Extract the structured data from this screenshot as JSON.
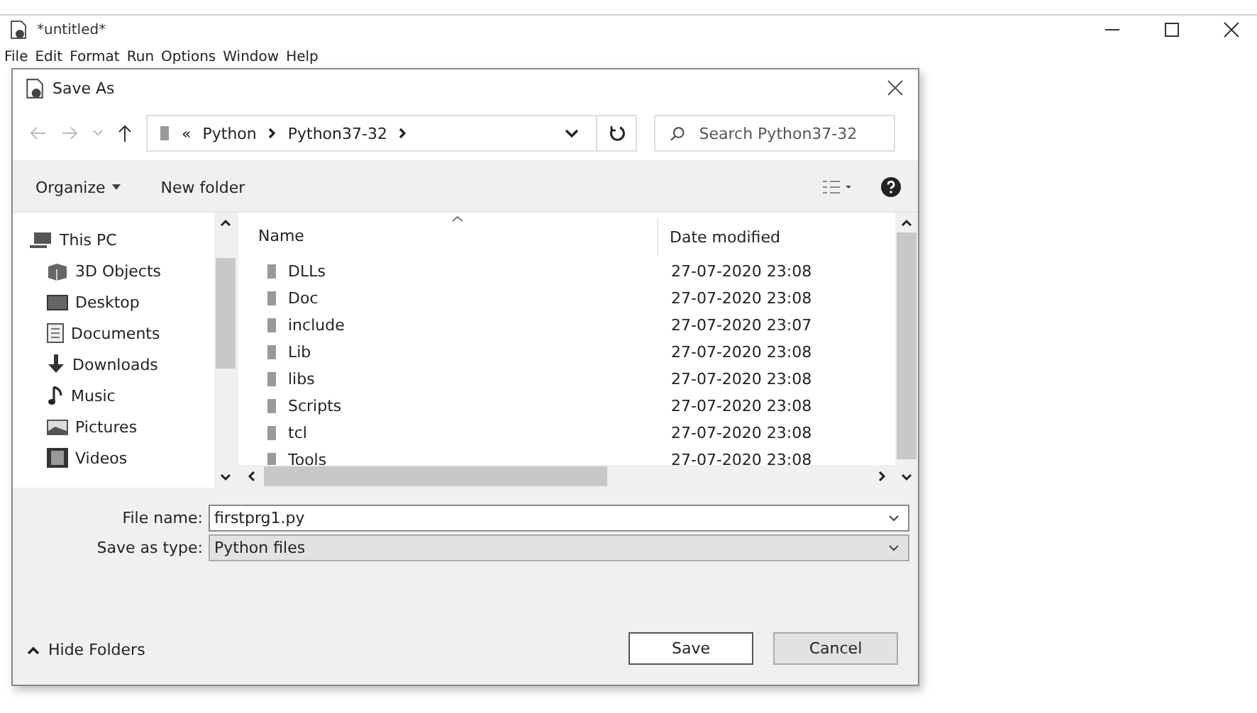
{
  "window": {
    "title": "*untitled*",
    "menu": [
      "File",
      "Edit",
      "Format",
      "Run",
      "Options",
      "Window",
      "Help"
    ]
  },
  "dialog": {
    "title": "Save As",
    "address": {
      "overflow_mark": "«",
      "path": [
        "Python",
        "Python37-32"
      ]
    },
    "search": {
      "placeholder": "Search Python37-32"
    },
    "toolbar": {
      "organize": "Organize",
      "new_folder": "New folder"
    },
    "sidebar": {
      "items": [
        {
          "label": "This PC",
          "kind": "pc",
          "children": [
            {
              "label": "3D Objects",
              "kind": "cube"
            },
            {
              "label": "Desktop",
              "kind": "desktop"
            },
            {
              "label": "Documents",
              "kind": "documents"
            },
            {
              "label": "Downloads",
              "kind": "downloads"
            },
            {
              "label": "Music",
              "kind": "music"
            },
            {
              "label": "Pictures",
              "kind": "pictures"
            },
            {
              "label": "Videos",
              "kind": "videos"
            }
          ]
        }
      ]
    },
    "table": {
      "columns": [
        "Name",
        "Date modified"
      ],
      "rows": [
        {
          "name": "DLLs",
          "date": "27-07-2020 23:08"
        },
        {
          "name": "Doc",
          "date": "27-07-2020 23:08"
        },
        {
          "name": "include",
          "date": "27-07-2020 23:07"
        },
        {
          "name": "Lib",
          "date": "27-07-2020 23:08"
        },
        {
          "name": "libs",
          "date": "27-07-2020 23:08"
        },
        {
          "name": "Scripts",
          "date": "27-07-2020 23:08"
        },
        {
          "name": "tcl",
          "date": "27-07-2020 23:08"
        },
        {
          "name": "Tools",
          "date": "27-07-2020 23:08"
        }
      ]
    },
    "file_name": {
      "label": "File name:",
      "value": "firstprg1.py"
    },
    "save_as_type": {
      "label": "Save as type:",
      "value": "Python files"
    },
    "hide_folders": "Hide Folders",
    "buttons": [
      "Save",
      "Cancel"
    ]
  }
}
